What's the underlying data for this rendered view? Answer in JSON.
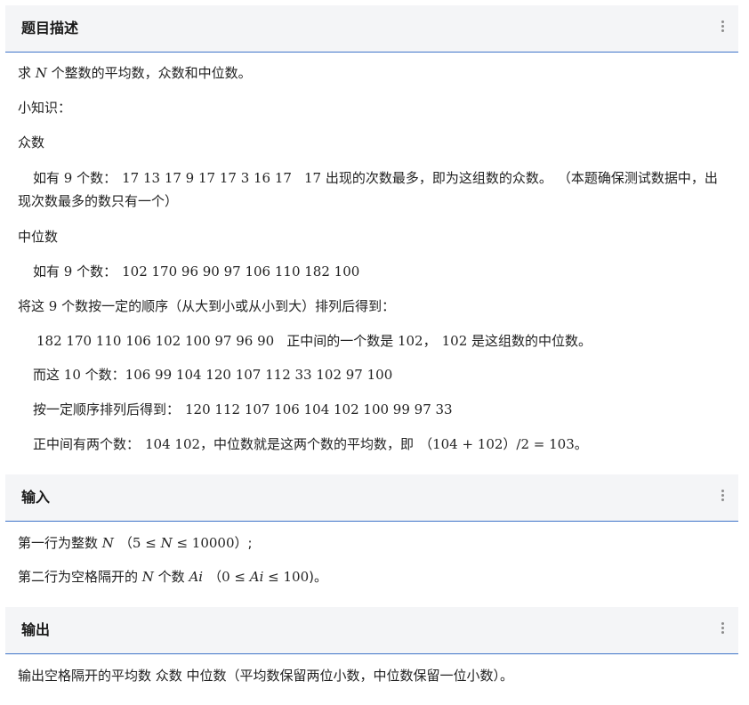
{
  "sections": {
    "description": {
      "title": "题目描述",
      "intro": {
        "a": "求 ",
        "var": "N",
        "b": " 个整数的平均数，众数和中位数。"
      },
      "knowledge": "小知识：",
      "mode_heading": "众数",
      "mode_example": {
        "a": "如有 ",
        "n": "9",
        "b": " 个数：",
        "nums": "17 13 17 9 17 17 3 16 17",
        "c": "17",
        "d": " 出现的次数最多，即为这组数的众数。",
        "e": "（本题确保测试数据中，出现次数最多的数只有一个）"
      },
      "median_heading": "中位数",
      "median_example": {
        "a": "如有 ",
        "n": "9",
        "b": " 个数：",
        "nums": "102 170 96 90 97 106 110 182 100"
      },
      "sort_line": {
        "a": "将这 ",
        "n": "9",
        "b": " 个数按一定的顺序（从大到小或从小到大）排列后得到："
      },
      "sorted_line": {
        "nums": "182 170 110 106 102 100 97 96 90",
        "a": "正中间的一个数是 ",
        "m": "102",
        "b": "，",
        "m2": "102",
        "c": " 是这组数的中位数。"
      },
      "ten_line": {
        "a": "而这 ",
        "n": "10",
        "b": " 个数：",
        "nums": "106 99 104 120 107 112 33 102 97 100"
      },
      "sorted_ten_line": {
        "a": "按一定顺序排列后得到：",
        "nums": "120 112 107 106 104 102 100 99 97 33"
      },
      "middle_two_line": {
        "a": "正中间有两个数：",
        "nums": "104 102",
        "b": "，中位数就是这两个数的平均数，即",
        "expr": "（104 + 102）/2 = 103",
        "c": "。"
      }
    },
    "input": {
      "title": "输入",
      "line1": {
        "a": "第一行为整数 ",
        "var": "N",
        "expr": "（5 ≤ ",
        "var2": "N",
        "expr2": " ≤ 10000",
        "b": "）;"
      },
      "line2": {
        "a": "第二行为空格隔开的 ",
        "var": "N",
        "b": " 个数 ",
        "var2": "Ai",
        "expr": "（0 ≤ ",
        "var3": "Ai",
        "expr2": " ≤ 100",
        "c": ")。"
      }
    },
    "output": {
      "title": "输出",
      "line1": "输出空格隔开的平均数 众数 中位数（平均数保留两位小数，中位数保留一位小数）。"
    }
  }
}
